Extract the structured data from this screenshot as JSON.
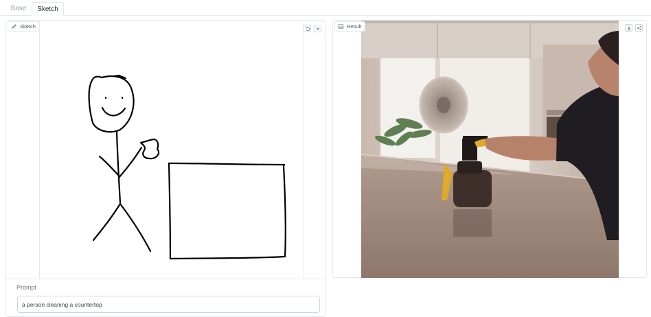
{
  "tabs": [
    {
      "label": "Base",
      "active": false
    },
    {
      "label": "Sketch",
      "active": true
    }
  ],
  "sketch_panel": {
    "label": "Sketch",
    "icons": [
      "pencil-icon",
      "undo-icon",
      "close-icon"
    ]
  },
  "prompt": {
    "label": "Prompt",
    "value": "a person cleaning a countertop"
  },
  "result_panel": {
    "label": "Result",
    "icons": [
      "image-icon",
      "download-icon",
      "share-icon"
    ]
  }
}
